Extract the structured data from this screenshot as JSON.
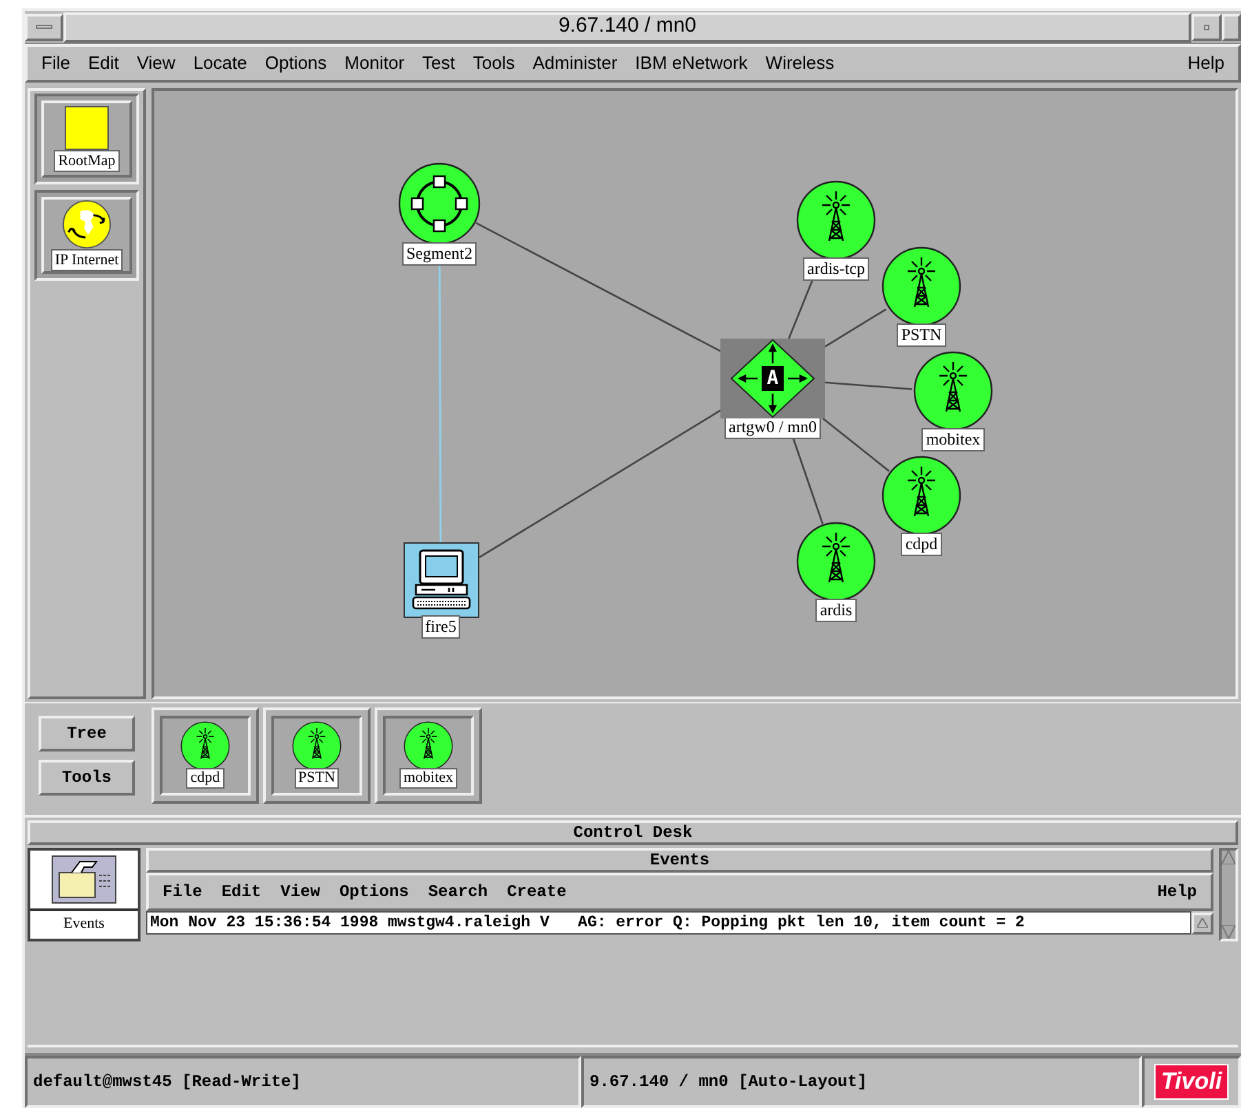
{
  "window": {
    "title": "9.67.140 / mn0"
  },
  "menu": [
    "File",
    "Edit",
    "View",
    "Locate",
    "Options",
    "Monitor",
    "Test",
    "Tools",
    "Administer",
    "IBM eNetwork",
    "Wireless"
  ],
  "menu_help": "Help",
  "sidebar": [
    {
      "label": "RootMap",
      "kind": "map"
    },
    {
      "label": "IP Internet",
      "kind": "globe"
    }
  ],
  "map": {
    "nodes": [
      {
        "label": "Segment2",
        "kind": "segment"
      },
      {
        "label": "ardis-tcp",
        "kind": "tower"
      },
      {
        "label": "PSTN",
        "kind": "tower"
      },
      {
        "label": "artgw0 / mn0",
        "kind": "gateway",
        "badge": "A"
      },
      {
        "label": "mobitex",
        "kind": "tower"
      },
      {
        "label": "cdpd",
        "kind": "tower"
      },
      {
        "label": "fire5",
        "kind": "computer"
      },
      {
        "label": "ardis",
        "kind": "tower"
      }
    ]
  },
  "tray": {
    "buttons": [
      "Tree",
      "Tools"
    ],
    "items": [
      {
        "label": "cdpd",
        "kind": "tower"
      },
      {
        "label": "PSTN",
        "kind": "tower"
      },
      {
        "label": "mobitex",
        "kind": "tower"
      }
    ]
  },
  "control_desk": {
    "title": "Control Desk",
    "launcher": {
      "label": "Events"
    },
    "events": {
      "title": "Events",
      "menu": [
        "File",
        "Edit",
        "View",
        "Options",
        "Search",
        "Create"
      ],
      "help": "Help",
      "message": "Mon Nov 23 15:36:54 1998 mwstgw4.raleigh V   AG: error Q: Popping pkt len 10, item count = 2"
    }
  },
  "status_bar": {
    "mode": "default@mwst45 [Read-Write]",
    "map": "9.67.140 / mn0 [Auto-Layout]",
    "logo": "Tivoli"
  }
}
